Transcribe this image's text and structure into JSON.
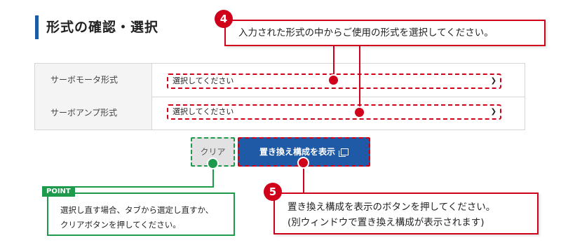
{
  "section": {
    "title": "形式の確認・選択"
  },
  "selection_table": {
    "rows": [
      {
        "label": "サーボモータ形式",
        "select_value": "選択してください"
      },
      {
        "label": "サーボアンプ形式",
        "select_value": "選択してください"
      }
    ]
  },
  "buttons": {
    "clear_label": "クリア",
    "show_label": "置き換え構成を表示",
    "show_icon": "new-window-icon",
    "select_chevron_icon": "chevron-down-icon"
  },
  "callouts": {
    "step4": {
      "number": "4",
      "text": "入力された形式の中からご使用の形式を選択してください。"
    },
    "step5": {
      "number": "5",
      "line1": "置き換え構成を表示のボタンを押してください。",
      "line2": "(別ウィンドウで置き換え構成が表示されます)"
    },
    "point": {
      "tag": "POINT",
      "line1": "選択し直す場合、タブから選定し直すか、",
      "line2": "クリアボタンを押してください。"
    }
  },
  "colors": {
    "brand_blue": "#1f5aa6",
    "callout_red": "#d0001b",
    "point_green": "#1e9a4c"
  }
}
